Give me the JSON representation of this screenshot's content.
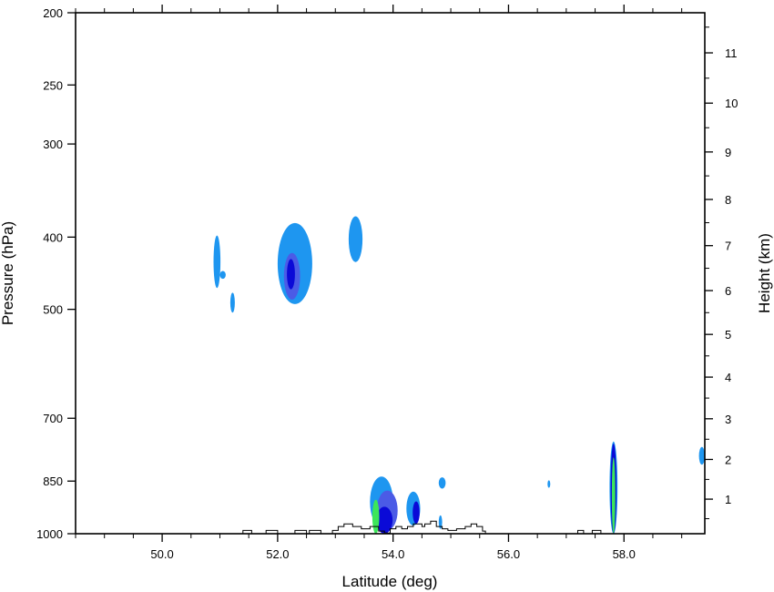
{
  "chart_data": {
    "type": "contour",
    "xlabel": "Latitude (deg)",
    "ylabel_left": "Pressure (hPa)",
    "ylabel_right": "Height (km)",
    "xlim": [
      48.5,
      59.4
    ],
    "x_ticks": [
      {
        "v": 50.0,
        "label": "50.0"
      },
      {
        "v": 52.0,
        "label": "52.0"
      },
      {
        "v": 54.0,
        "label": "54.0"
      },
      {
        "v": 56.0,
        "label": "56.0"
      },
      {
        "v": 58.0,
        "label": "58.0"
      }
    ],
    "x_minor_step": 0.5,
    "ylim_pressure": [
      1000,
      200
    ],
    "y_scale": "log",
    "pressure_ticks": [
      {
        "v": 200,
        "label": "200"
      },
      {
        "v": 250,
        "label": "250"
      },
      {
        "v": 300,
        "label": "300"
      },
      {
        "v": 400,
        "label": "400"
      },
      {
        "v": 500,
        "label": "500"
      },
      {
        "v": 700,
        "label": "700"
      },
      {
        "v": 850,
        "label": "850"
      },
      {
        "v": 1000,
        "label": "1000"
      }
    ],
    "height_ticks_km": [
      {
        "v": 1,
        "label": "1"
      },
      {
        "v": 2,
        "label": "2"
      },
      {
        "v": 3,
        "label": "3"
      },
      {
        "v": 4,
        "label": "4"
      },
      {
        "v": 5,
        "label": "5"
      },
      {
        "v": 6,
        "label": "6"
      },
      {
        "v": 7,
        "label": "7"
      },
      {
        "v": 8,
        "label": "8"
      },
      {
        "v": 9,
        "label": "9"
      },
      {
        "v": 10,
        "label": "10"
      },
      {
        "v": 11,
        "label": "11"
      }
    ],
    "colors": {
      "level1": "#1e96f0",
      "level2": "#4b5be6",
      "level3": "#0a0ad7",
      "level4": "#3ce65a",
      "terrain": "#000000"
    },
    "features": [
      {
        "lat": 50.95,
        "p_top": 398,
        "p_bot": 468,
        "half_width": 0.06,
        "level": 1
      },
      {
        "lat": 51.05,
        "p_top": 444,
        "p_bot": 455,
        "half_width": 0.05,
        "level": 1
      },
      {
        "lat": 51.22,
        "p_top": 475,
        "p_bot": 505,
        "half_width": 0.04,
        "level": 1
      },
      {
        "lat": 52.3,
        "p_top": 383,
        "p_bot": 492,
        "half_width": 0.3,
        "level": 1
      },
      {
        "lat": 52.25,
        "p_top": 420,
        "p_bot": 485,
        "half_width": 0.14,
        "level": 2
      },
      {
        "lat": 52.23,
        "p_top": 428,
        "p_bot": 470,
        "half_width": 0.07,
        "level": 3
      },
      {
        "lat": 53.35,
        "p_top": 375,
        "p_bot": 432,
        "half_width": 0.12,
        "level": 1
      },
      {
        "lat": 53.8,
        "p_top": 838,
        "p_bot": 980,
        "half_width": 0.2,
        "level": 1
      },
      {
        "lat": 53.9,
        "p_top": 875,
        "p_bot": 990,
        "half_width": 0.18,
        "level": 2
      },
      {
        "lat": 53.85,
        "p_top": 920,
        "p_bot": 1000,
        "half_width": 0.14,
        "level": 3
      },
      {
        "lat": 53.7,
        "p_top": 900,
        "p_bot": 1000,
        "half_width": 0.06,
        "level": 4
      },
      {
        "lat": 54.35,
        "p_top": 878,
        "p_bot": 975,
        "half_width": 0.12,
        "level": 1
      },
      {
        "lat": 54.4,
        "p_top": 905,
        "p_bot": 970,
        "half_width": 0.06,
        "level": 3
      },
      {
        "lat": 54.85,
        "p_top": 840,
        "p_bot": 870,
        "half_width": 0.06,
        "level": 1
      },
      {
        "lat": 54.82,
        "p_top": 945,
        "p_bot": 985,
        "half_width": 0.03,
        "level": 1
      },
      {
        "lat": 56.7,
        "p_top": 848,
        "p_bot": 868,
        "half_width": 0.02,
        "level": 1
      },
      {
        "lat": 57.82,
        "p_top": 752,
        "p_bot": 1000,
        "half_width": 0.07,
        "level": 1
      },
      {
        "lat": 57.82,
        "p_top": 757,
        "p_bot": 1000,
        "half_width": 0.05,
        "level": 3
      },
      {
        "lat": 57.82,
        "p_top": 790,
        "p_bot": 1000,
        "half_width": 0.03,
        "level": 4
      },
      {
        "lat": 59.35,
        "p_top": 765,
        "p_bot": 808,
        "half_width": 0.05,
        "level": 1
      }
    ],
    "terrain": [
      [
        48.5,
        1000
      ],
      [
        51.4,
        1000
      ],
      [
        51.4,
        990
      ],
      [
        51.55,
        990
      ],
      [
        51.55,
        1000
      ],
      [
        51.8,
        1000
      ],
      [
        51.8,
        990
      ],
      [
        52.0,
        990
      ],
      [
        52.0,
        1000
      ],
      [
        52.3,
        1000
      ],
      [
        52.3,
        990
      ],
      [
        52.5,
        990
      ],
      [
        52.5,
        1000
      ],
      [
        52.55,
        1000
      ],
      [
        52.55,
        990
      ],
      [
        52.75,
        990
      ],
      [
        52.75,
        1000
      ],
      [
        52.95,
        1000
      ],
      [
        52.95,
        990
      ],
      [
        53.05,
        990
      ],
      [
        53.05,
        978
      ],
      [
        53.15,
        978
      ],
      [
        53.15,
        970
      ],
      [
        53.3,
        970
      ],
      [
        53.3,
        978
      ],
      [
        53.45,
        978
      ],
      [
        53.45,
        985
      ],
      [
        53.6,
        985
      ],
      [
        53.6,
        978
      ],
      [
        53.75,
        978
      ],
      [
        53.75,
        992
      ],
      [
        53.85,
        992
      ],
      [
        53.85,
        998
      ],
      [
        53.95,
        998
      ],
      [
        53.95,
        985
      ],
      [
        54.05,
        985
      ],
      [
        54.05,
        978
      ],
      [
        54.15,
        978
      ],
      [
        54.15,
        985
      ],
      [
        54.25,
        985
      ],
      [
        54.25,
        978
      ],
      [
        54.35,
        978
      ],
      [
        54.35,
        970
      ],
      [
        54.5,
        970
      ],
      [
        54.5,
        978
      ],
      [
        54.55,
        978
      ],
      [
        54.55,
        970
      ],
      [
        54.65,
        970
      ],
      [
        54.65,
        962
      ],
      [
        54.75,
        962
      ],
      [
        54.75,
        978
      ],
      [
        54.85,
        978
      ],
      [
        54.85,
        985
      ],
      [
        54.95,
        985
      ],
      [
        54.95,
        990
      ],
      [
        55.1,
        990
      ],
      [
        55.1,
        985
      ],
      [
        55.25,
        985
      ],
      [
        55.25,
        978
      ],
      [
        55.35,
        978
      ],
      [
        55.35,
        970
      ],
      [
        55.45,
        970
      ],
      [
        55.45,
        978
      ],
      [
        55.55,
        978
      ],
      [
        55.55,
        992
      ],
      [
        55.6,
        992
      ],
      [
        55.6,
        1000
      ],
      [
        57.2,
        1000
      ],
      [
        57.2,
        990
      ],
      [
        57.3,
        990
      ],
      [
        57.3,
        1000
      ],
      [
        57.45,
        1000
      ],
      [
        57.45,
        990
      ],
      [
        57.6,
        990
      ],
      [
        57.6,
        1000
      ],
      [
        59.4,
        1000
      ]
    ]
  }
}
